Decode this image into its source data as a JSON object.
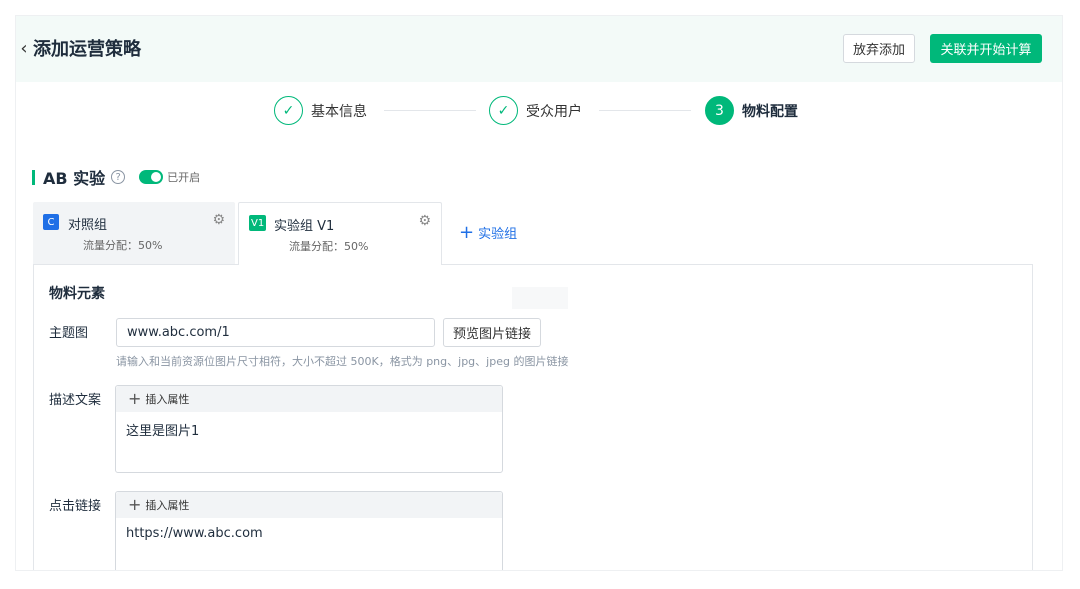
{
  "header": {
    "back_icon": "chevron-left-icon",
    "title": "添加运营策略",
    "discard_label": "放弃添加",
    "submit_label": "关联并开始计算",
    "accent": "#00b87a"
  },
  "steps": [
    {
      "label": "基本信息",
      "state": "done",
      "icon": "check-icon"
    },
    {
      "label": "受众用户",
      "state": "done",
      "icon": "check-icon"
    },
    {
      "label": "物料配置",
      "state": "active",
      "number": "3"
    }
  ],
  "ab": {
    "title": "AB 实验",
    "help_icon": "question-icon",
    "toggle_label": "已开启",
    "enabled": true
  },
  "groups": [
    {
      "badge": "C",
      "name": "对照组",
      "traffic": "流量分配：50%",
      "badge_color": "#1f6fe6"
    },
    {
      "badge": "V1",
      "name": "实验组 V1",
      "traffic": "流量分配：50%",
      "badge_color": "#00b87a"
    }
  ],
  "add_group_label": "实验组",
  "material": {
    "section_title": "物料元素",
    "theme_image": {
      "label": "主题图",
      "value": "www.abc.com/1",
      "preview_label": "预览图片链接",
      "hint": "请输入和当前资源位图片尺寸相符，大小不超过 500K，格式为 png、jpg、jpeg 的图片链接"
    },
    "description": {
      "label": "描述文案",
      "insert_label": "插入属性",
      "content": "这里是图片1"
    },
    "click_link": {
      "label": "点击链接",
      "insert_label": "插入属性",
      "content": "https://www.abc.com"
    }
  }
}
